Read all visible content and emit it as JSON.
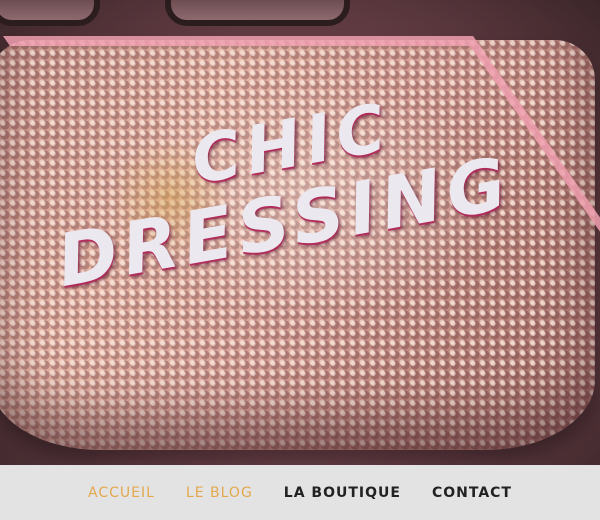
{
  "hero": {
    "title_line1": "CHIC",
    "title_line2": "DRESSING"
  },
  "nav": {
    "items": [
      {
        "label": "ACCUEIL",
        "color": "#e4a84d"
      },
      {
        "label": "LE BLOG",
        "color": "#e4a84d"
      },
      {
        "label": "LA BOUTIQUE",
        "color": "#222222"
      },
      {
        "label": "CONTACT",
        "color": "#222222"
      }
    ]
  },
  "colors": {
    "nav_background": "#e3e3e3",
    "title_text": "#ece8ef",
    "title_shadow": "#b4285a"
  }
}
